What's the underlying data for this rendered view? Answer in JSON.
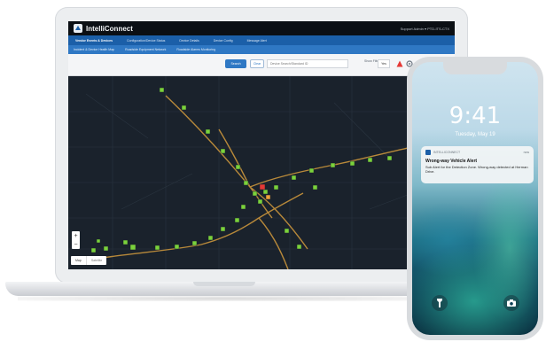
{
  "app": {
    "title": "IntelliConnect",
    "support": "Support Admin ▾ PTD-ITS-CTX"
  },
  "nav": {
    "primary": [
      "Vendor Events & Devices",
      "Configuration/Device Status",
      "Device Details",
      "Device Config",
      "Message Alert"
    ],
    "secondary": [
      "Incident & Device Health Map",
      "Roadside Equipment Network",
      "Roadside Alarms Monitoring"
    ]
  },
  "toolbar": {
    "primary_label": "Search",
    "secondary_label": "Clear",
    "search_placeholder": "Device Search/Standard ID",
    "show_label": "Show Filter",
    "show_value": "Yes"
  },
  "map": {
    "zoom_in": "+",
    "zoom_out": "−",
    "map_label": "Map",
    "satellite_label": "Satellite"
  },
  "phone": {
    "time": "9:41",
    "date": "Tuesday, May 19",
    "notification": {
      "app": "INTELLICONNECT",
      "time": "now",
      "title": "Wrong-way Vehicle Alert",
      "body": "Sub Alert for the Detection Zone. Wrong-way detected at Herman Drive."
    },
    "icons": [
      "flashlight-icon",
      "camera-icon"
    ]
  },
  "colors": {
    "nav_primary": "#1b5fa8",
    "nav_secondary": "#2f78c4",
    "device_marker": "#7bd23b",
    "alert_marker": "#e53935",
    "road": "#b8893a"
  }
}
